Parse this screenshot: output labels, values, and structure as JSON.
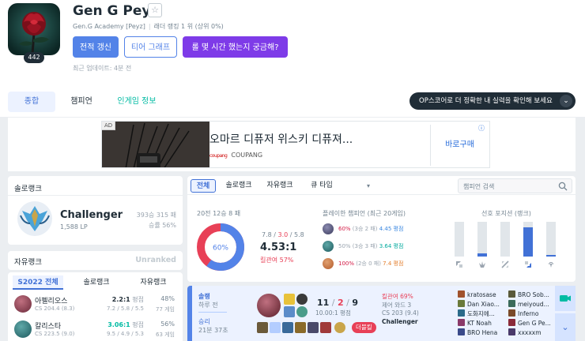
{
  "profile": {
    "name": "Gen G Peyz",
    "level": "442",
    "team": "Gen.G Academy [Peyz]",
    "ladder": "래더 랭킹 1 위 (상위 0%)",
    "updated": "최근 업데이트: 4분 전",
    "fav_icon": "☆"
  },
  "buttons": {
    "renew": "전적 갱신",
    "tier_graph": "티어 그래프",
    "time_spent": "롤 몇 시간 했는지 궁금해?"
  },
  "tabs": {
    "overview": "종합",
    "champion": "챔피언",
    "ingame": "인게임 정보"
  },
  "ops_banner": {
    "text": "OP스코어로 더 정확한 내 실력을 확인해 보세요",
    "chevron": "⌄"
  },
  "ad": {
    "tag": "AD",
    "title": "오마르 디퓨저 위스키 디퓨져...",
    "brand": "COUPANG",
    "brand_logo": "coupang",
    "cta": "바로구매",
    "info_icon": "ⓘ"
  },
  "solo_rank": {
    "title": "솔로랭크",
    "tier": "Challenger",
    "lp": "1,588 LP",
    "record": "393승 315 패",
    "winrate": "승률 56%"
  },
  "flex_rank": {
    "title": "자유랭크",
    "status": "Unranked"
  },
  "season_tabs": {
    "all": "S2022 전체",
    "solo": "솔로랭크",
    "flex": "자유랭크"
  },
  "champions": [
    {
      "name": "아펠리오스",
      "cs": "CS 204.4 (8.3)",
      "kda": "2.2:1",
      "kda_tail": " 평점",
      "detail": "7.2 / 5.8 / 5.5",
      "winrate": "48%",
      "games": "77 게임",
      "color": "#6a2a3a"
    },
    {
      "name": "칼리스타",
      "cs": "CS 223.5 (9.0)",
      "kda": "3.06:1",
      "kda_tail": " 평점",
      "detail": "9.5 / 4.9 / 5.3",
      "winrate": "56%",
      "games": "63 게임",
      "color": "#1e5a5e"
    }
  ],
  "queue_tabs": {
    "all": "전체",
    "solo": "솔로랭크",
    "flex": "자유랭크",
    "type": "큐 타입",
    "caret": "▾"
  },
  "search": {
    "placeholder": "챔피언 검색"
  },
  "summary": {
    "record": "20전 12승 8 패",
    "winrate_label": "60%",
    "winrate": 0.6,
    "kda_k": "7.8",
    "kda_sep1": " / ",
    "kda_d": "3.0",
    "kda_sep2": " / ",
    "kda_a": "5.8",
    "ratio": "4.53:1",
    "kp": "킬관여 57%"
  },
  "played_champions": {
    "title": "플레이한 챔피언 (최근 20게임)",
    "rows": [
      {
        "wr": "60%",
        "rec": " (3승 2 패) ",
        "kda": "4.45 평점",
        "color": "#3b3b5c"
      },
      {
        "wr": "50%",
        "rec": " (3승 3 패) ",
        "kda": "3.64 평점",
        "color": "#1e5a5e"
      },
      {
        "wr": "100%",
        "rec": " (2승 0 패) ",
        "kda": "7.4 평점",
        "color": "#b35a2a"
      }
    ]
  },
  "positions": {
    "title": "선호 포지션 (랭크)",
    "levels": [
      0,
      0.1,
      0,
      0.85,
      0.05
    ],
    "icons": [
      "top-icon",
      "jungle-icon",
      "mid-icon",
      "bot-icon",
      "support-icon"
    ]
  },
  "match": {
    "queue": "솔랭",
    "time": "하루 전",
    "result": "승리",
    "length": "21분 37초",
    "k": "11",
    "d": "2",
    "a": "9",
    "kda_ratio": "10.00:1 평점",
    "badge": "더블킬",
    "kp": "킬관여 69%",
    "wards": "제어 와드 3",
    "cs": "CS 203 (9.4)",
    "rank": "Challenger",
    "expand_icon": "⌄",
    "team_a": [
      "kratosase",
      "Dan Xiao...",
      "도화지에...",
      "KT Noah",
      "BRO Hena"
    ],
    "team_b": [
      "BRO Sob...",
      "meiyoud...",
      "Inferno",
      "Gen G Pe...",
      "xxxxxm"
    ]
  }
}
